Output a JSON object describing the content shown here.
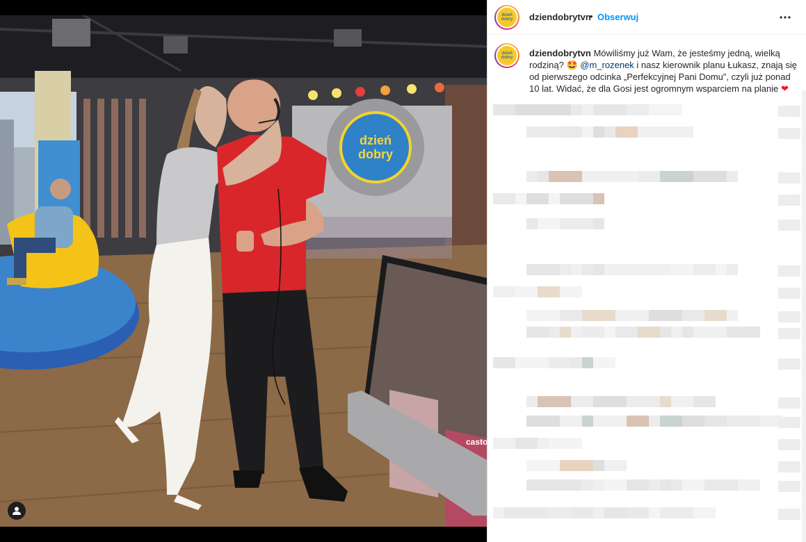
{
  "post": {
    "username": "dziendobrytvn",
    "separator": "•",
    "follow_label": "Obserwuj",
    "more_icon": "more-horizontal-icon",
    "avatar_text_top": "dzień",
    "avatar_text_bottom": "dobry"
  },
  "caption": {
    "username": "dziendobrytvn",
    "text_1": " Mówiliśmy już Wam, że jesteśmy jedną, wielką rodziną? ",
    "emoji_1": "🤩",
    "mention": "@m_rozenek",
    "text_2": " i nasz kierownik planu Łukasz, znają się od pierwszego odcinka „Perfekcyjnej Pani Domu”, czyli już ponad 10 lat. Widać, że dla Gosi jest ogromnym wsparciem na planie ",
    "emoji_2": "❤"
  },
  "photo": {
    "set_logo_top": "dzień",
    "set_logo_bottom": "dobry",
    "tv_fragment": "casto",
    "tag_icon": "user-tag-icon"
  },
  "colors": {
    "link": "#0095f6",
    "mention": "#00376b",
    "text": "#262626",
    "heart": "#ed1c24"
  }
}
